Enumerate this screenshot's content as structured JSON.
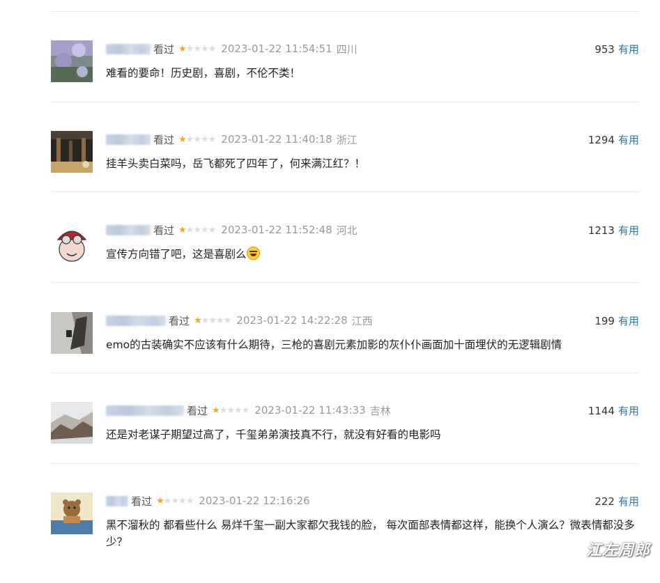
{
  "comments": [
    {
      "status": "看过",
      "rating": 1,
      "time": "2023-01-22 11:54:51",
      "location": "四川",
      "useful_count": "953",
      "useful_label": "有用",
      "content": "难看的要命！历史剧，喜剧，不伦不类！",
      "avatar_colors": [
        "#7a8796",
        "#a4a0c7",
        "#556b53"
      ]
    },
    {
      "status": "看过",
      "rating": 1,
      "time": "2023-01-22 11:40:18",
      "location": "浙江",
      "useful_count": "1294",
      "useful_label": "有用",
      "content": "挂羊头卖白菜吗，岳飞都死了四年了，何来满江红？！",
      "avatar_colors": [
        "#2a2622",
        "#8b6a44",
        "#c9a46a"
      ]
    },
    {
      "status": "看过",
      "rating": 1,
      "time": "2023-01-22 11:52:48",
      "location": "河北",
      "useful_count": "1213",
      "useful_label": "有用",
      "content": "宣传方向错了吧，这是喜剧么",
      "avatar_colors": [
        "#ffffff",
        "#b3262d",
        "#f4d8d0"
      ]
    },
    {
      "status": "看过",
      "rating": 1,
      "time": "2023-01-22 14:22:28",
      "location": "江西",
      "useful_count": "199",
      "useful_label": "有用",
      "content": "emo的古装确实不应该有什么期待，三枪的喜剧元素加影的灰仆仆画面加十面埋伏的无逻辑剧情",
      "avatar_colors": [
        "#c9c7c3",
        "#3b3a38",
        "#8d8a85"
      ]
    },
    {
      "status": "看过",
      "rating": 1,
      "time": "2023-01-22 11:43:33",
      "location": "吉林",
      "useful_count": "1144",
      "useful_label": "有用",
      "content": "还是对老谋子期望过高了，千玺弟弟演技真不行，就没有好看的电影吗",
      "avatar_colors": [
        "#e6e8ea",
        "#6f5d52",
        "#b9b3ad"
      ]
    },
    {
      "status": "看过",
      "rating": 1,
      "time": "2023-01-22 12:16:26",
      "location": "",
      "useful_count": "222",
      "useful_label": "有用",
      "content": "黑不溜秋的 都看些什么 易烊千玺一副大家都欠我钱的脸， 每次面部表情都这样，能换个人演么？微表情都没多少？",
      "avatar_colors": [
        "#f0e6c8",
        "#9a6a3a",
        "#4d7da6"
      ]
    }
  ],
  "watermark": "江左周郎"
}
